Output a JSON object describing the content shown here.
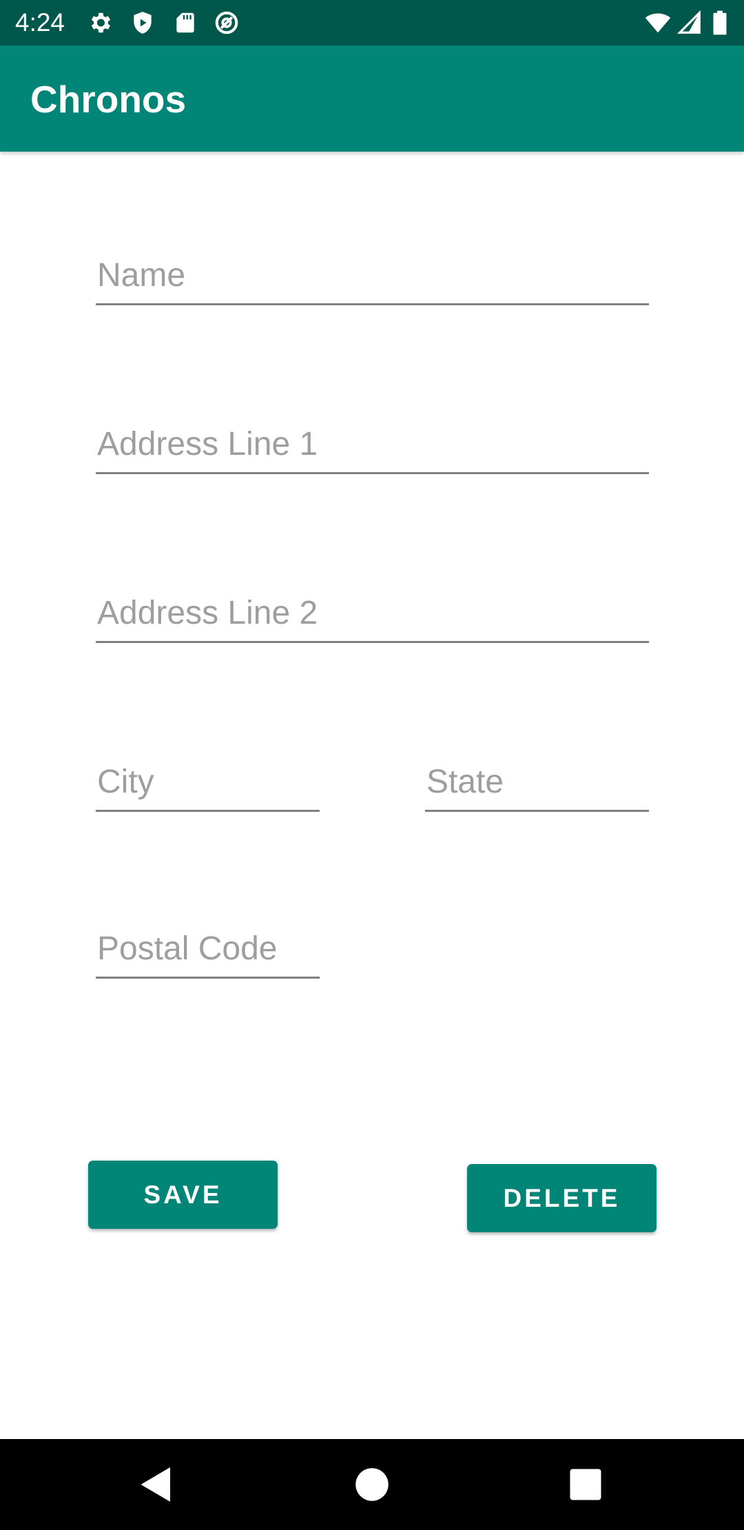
{
  "status_bar": {
    "time": "4:24",
    "left_icons": [
      "gear-icon",
      "shield-play-icon",
      "sd-card-icon",
      "at-sign-icon"
    ],
    "right_icons": [
      "wifi-icon",
      "cell-signal-icon",
      "battery-icon"
    ]
  },
  "app_bar": {
    "title": "Chronos",
    "color": "#008577",
    "status_color": "#00574b"
  },
  "form": {
    "name": {
      "placeholder": "Name",
      "value": ""
    },
    "address_line_1": {
      "placeholder": "Address Line 1",
      "value": ""
    },
    "address_line_2": {
      "placeholder": "Address Line 2",
      "value": ""
    },
    "city": {
      "placeholder": "City",
      "value": ""
    },
    "state": {
      "placeholder": "State",
      "value": ""
    },
    "postal_code": {
      "placeholder": "Postal Code",
      "value": ""
    }
  },
  "actions": {
    "save_label": "SAVE",
    "delete_label": "DELETE",
    "accent": "#008577"
  },
  "nav_bar": {
    "items": [
      "back-icon",
      "home-icon",
      "recents-icon"
    ]
  }
}
